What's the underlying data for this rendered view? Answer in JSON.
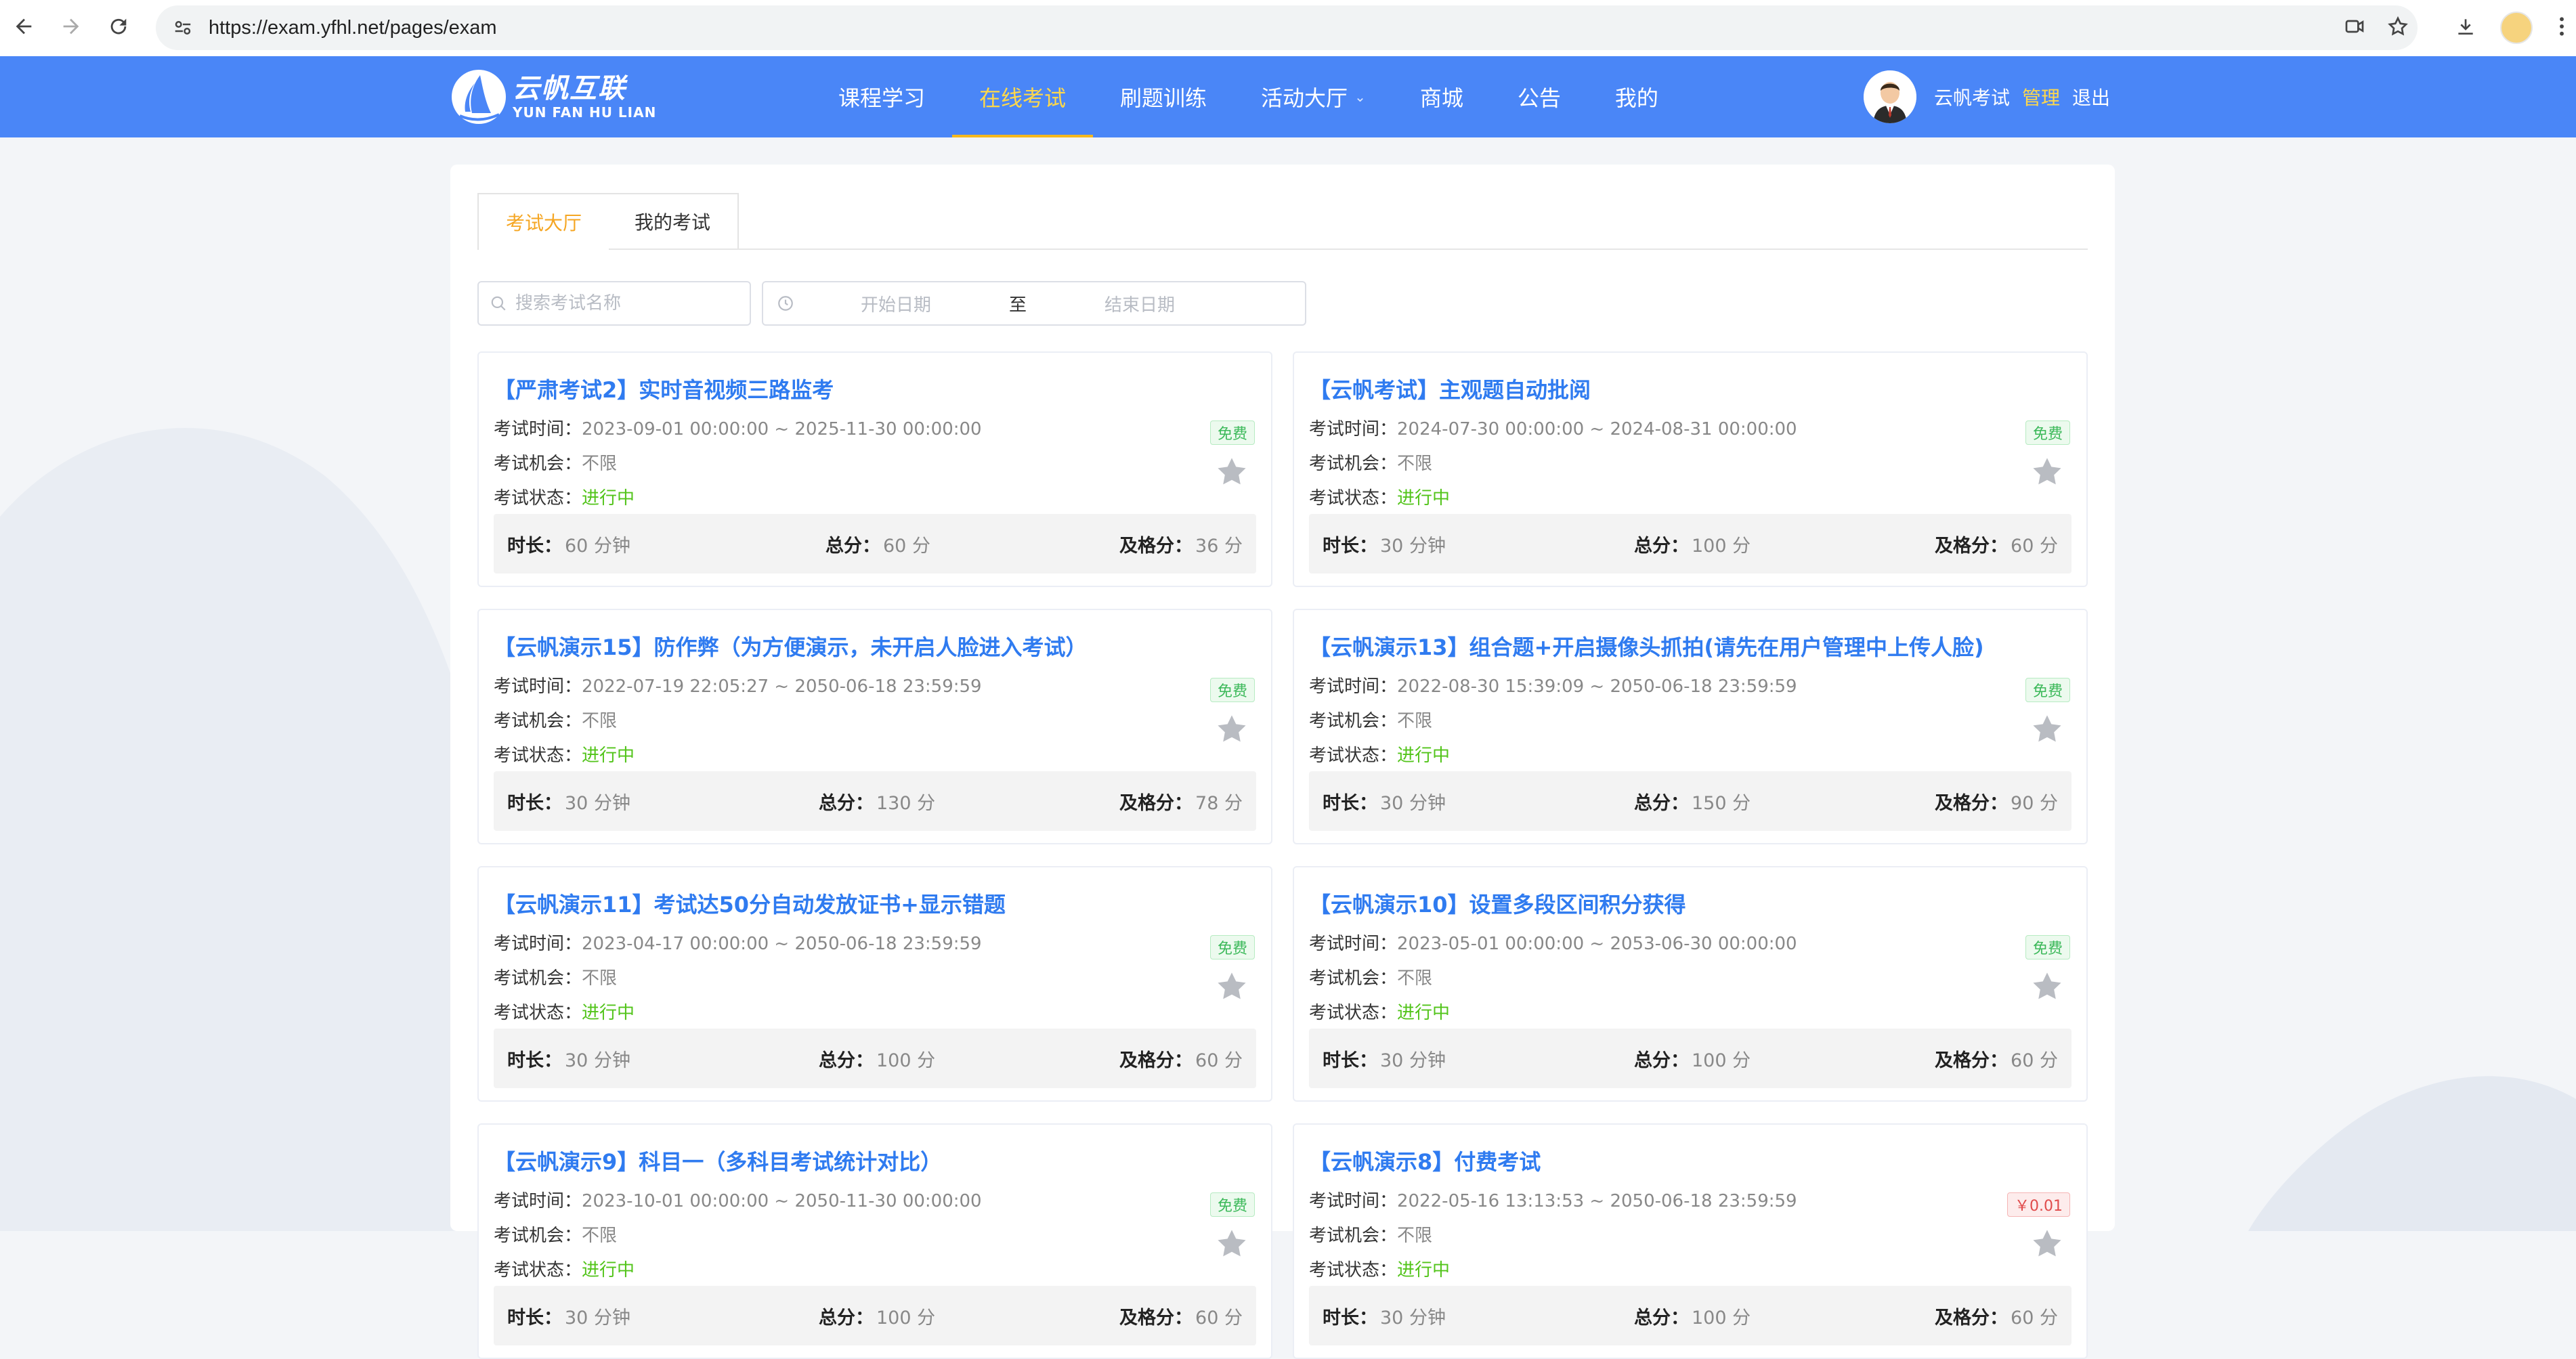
{
  "browser": {
    "url": "https://exam.yfhl.net/pages/exam"
  },
  "header": {
    "logo_cn": "云帆互联",
    "logo_en": "YUN FAN HU LIAN",
    "nav": [
      "课程学习",
      "在线考试",
      "刷题训练",
      "活动大厅",
      "商城",
      "公告",
      "我的"
    ],
    "active_nav": "在线考试",
    "user_name": "云帆考试",
    "admin_label": "管理",
    "logout_label": "退出"
  },
  "tabs": [
    "考试大厅",
    "我的考试"
  ],
  "filters": {
    "search_placeholder": "搜索考试名称",
    "start_placeholder": "开始日期",
    "separator": "至",
    "end_placeholder": "结束日期"
  },
  "labels": {
    "time": "考试时间：",
    "chance": "考试机会：",
    "status": "考试状态：",
    "duration": "时长：",
    "total": "总分：",
    "pass": "及格分："
  },
  "exams": [
    {
      "title": "【严肃考试2】实时音视频三路监考",
      "time": "2023-09-01 00:00:00 ~ 2025-11-30 00:00:00",
      "chance": "不限",
      "status": "进行中",
      "badge": "免费",
      "duration": "60 分钟",
      "total": "60 分",
      "pass": "36 分"
    },
    {
      "title": "【云帆考试】主观题自动批阅",
      "time": "2024-07-30 00:00:00 ~ 2024-08-31 00:00:00",
      "chance": "不限",
      "status": "进行中",
      "badge": "免费",
      "duration": "30 分钟",
      "total": "100 分",
      "pass": "60 分"
    },
    {
      "title": "【云帆演示15】防作弊（为方便演示，未开启人脸进入考试）",
      "time": "2022-07-19 22:05:27 ~ 2050-06-18 23:59:59",
      "chance": "不限",
      "status": "进行中",
      "badge": "免费",
      "duration": "30 分钟",
      "total": "130 分",
      "pass": "78 分"
    },
    {
      "title": "【云帆演示13】组合题+开启摄像头抓拍(请先在用户管理中上传人脸)",
      "time": "2022-08-30 15:39:09 ~ 2050-06-18 23:59:59",
      "chance": "不限",
      "status": "进行中",
      "badge": "免费",
      "duration": "30 分钟",
      "total": "150 分",
      "pass": "90 分"
    },
    {
      "title": "【云帆演示11】考试达50分自动发放证书+显示错题",
      "time": "2023-04-17 00:00:00 ~ 2050-06-18 23:59:59",
      "chance": "不限",
      "status": "进行中",
      "badge": "免费",
      "duration": "30 分钟",
      "total": "100 分",
      "pass": "60 分"
    },
    {
      "title": "【云帆演示10】设置多段区间积分获得",
      "time": "2023-05-01 00:00:00 ~ 2053-06-30 00:00:00",
      "chance": "不限",
      "status": "进行中",
      "badge": "免费",
      "duration": "30 分钟",
      "total": "100 分",
      "pass": "60 分"
    },
    {
      "title": "【云帆演示9】科目一（多科目考试统计对比）",
      "time": "2023-10-01 00:00:00 ~ 2050-11-30 00:00:00",
      "chance": "不限",
      "status": "进行中",
      "badge": "免费",
      "duration": "30 分钟",
      "total": "100 分",
      "pass": "60 分"
    },
    {
      "title": "【云帆演示8】付费考试",
      "time": "2022-05-16 13:13:53 ~ 2050-06-18 23:59:59",
      "chance": "不限",
      "status": "进行中",
      "badge": "￥0.01",
      "duration": "30 分钟",
      "total": "100 分",
      "pass": "60 分"
    }
  ],
  "colors": {
    "header_bg": "#4a86f7",
    "accent": "#f5b81e",
    "link": "#2f7bf0",
    "status_ok": "#52c41a"
  }
}
